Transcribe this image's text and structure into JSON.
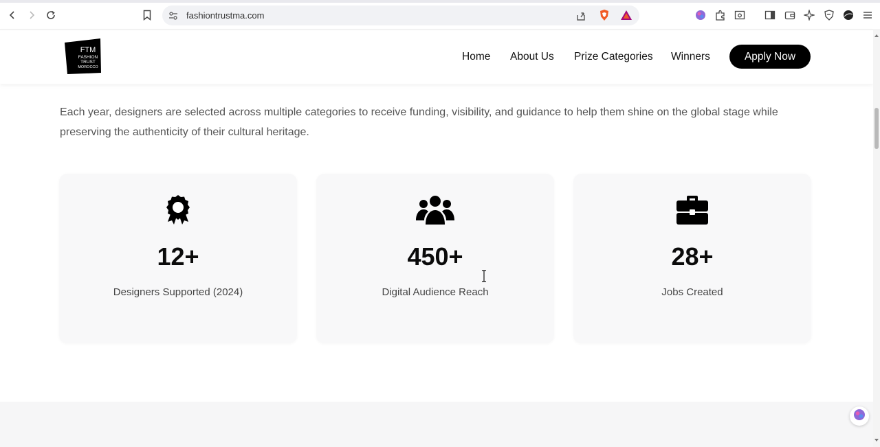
{
  "browser": {
    "url": "fashiontrustma.com",
    "icons": [
      "back-icon",
      "forward-icon",
      "reload-icon",
      "bookmark-icon",
      "site-settings-icon",
      "share-icon",
      "brave-shield-icon",
      "brave-rewards-icon",
      "leo-ai-icon",
      "extensions-icon",
      "screenshot-icon",
      "sidebar-icon",
      "wallet-icon",
      "sparkle-icon",
      "vpn-icon",
      "profile-icon",
      "menu-icon"
    ]
  },
  "header": {
    "logo_lines": [
      "FTM",
      "FASHION",
      "TRUST",
      "MOROCCO"
    ],
    "nav": [
      "Home",
      "About Us",
      "Prize Categories",
      "Winners"
    ],
    "cta": "Apply Now"
  },
  "intro": {
    "text": "Each year, designers are selected across multiple categories to receive funding, visibility, and guidance to help them shine on the global stage while preserving the authenticity of their cultural heritage."
  },
  "stats": [
    {
      "icon": "award-icon",
      "value": "12+",
      "label": "Designers Supported (2024)"
    },
    {
      "icon": "users-icon",
      "value": "450+",
      "label": "Digital Audience Reach"
    },
    {
      "icon": "briefcase-icon",
      "value": "28+",
      "label": "Jobs Created"
    }
  ],
  "colors": {
    "accent": "#000000",
    "card_bg": "#f8f8f9",
    "text_muted": "#555555"
  }
}
